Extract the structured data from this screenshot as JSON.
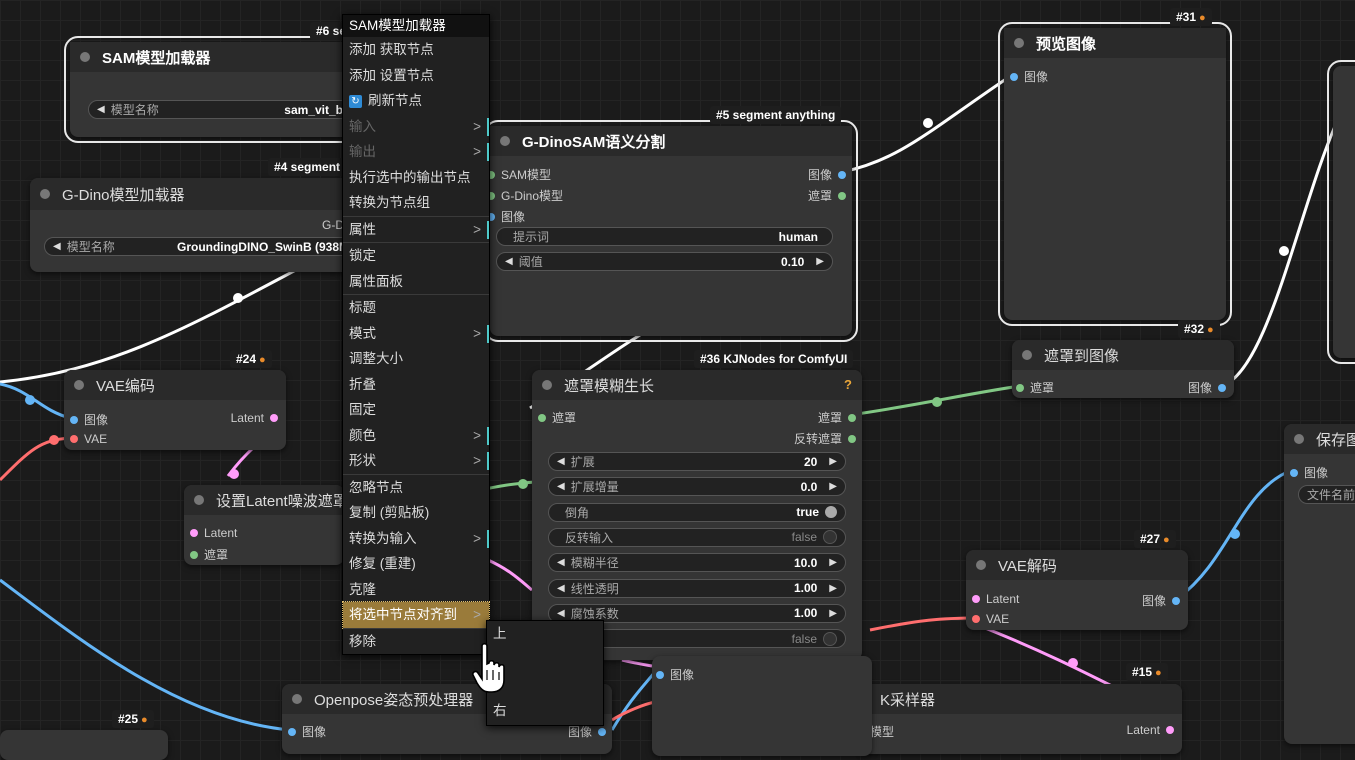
{
  "menu": {
    "title": "SAM模型加载器",
    "items": [
      {
        "label": "添加 获取节点",
        "submenu": false,
        "disabled": false,
        "sep": false
      },
      {
        "label": "添加 设置节点",
        "submenu": false,
        "disabled": false,
        "sep": false
      },
      {
        "label": "刷新节点",
        "submenu": false,
        "disabled": false,
        "sep": false,
        "icon": "refresh-icon"
      },
      {
        "label": "输入",
        "submenu": true,
        "disabled": true,
        "sep": false
      },
      {
        "label": "输出",
        "submenu": true,
        "disabled": true,
        "sep": false
      },
      {
        "label": "执行选中的输出节点",
        "submenu": false,
        "disabled": false,
        "sep": false
      },
      {
        "label": "转换为节点组",
        "submenu": false,
        "disabled": false,
        "sep": false
      },
      {
        "label": "属性",
        "submenu": true,
        "disabled": false,
        "sep": true
      },
      {
        "label": "锁定",
        "submenu": false,
        "disabled": false,
        "sep": true
      },
      {
        "label": "属性面板",
        "submenu": false,
        "disabled": false,
        "sep": false
      },
      {
        "label": "标题",
        "submenu": false,
        "disabled": false,
        "sep": true
      },
      {
        "label": "模式",
        "submenu": true,
        "disabled": false,
        "sep": false
      },
      {
        "label": "调整大小",
        "submenu": false,
        "disabled": false,
        "sep": false
      },
      {
        "label": "折叠",
        "submenu": false,
        "disabled": false,
        "sep": false
      },
      {
        "label": "固定",
        "submenu": false,
        "disabled": false,
        "sep": false
      },
      {
        "label": "颜色",
        "submenu": true,
        "disabled": false,
        "sep": false
      },
      {
        "label": "形状",
        "submenu": true,
        "disabled": false,
        "sep": false
      },
      {
        "label": "忽略节点",
        "submenu": false,
        "disabled": false,
        "sep": true
      },
      {
        "label": "复制 (剪贴板)",
        "submenu": false,
        "disabled": false,
        "sep": false
      },
      {
        "label": "转换为输入",
        "submenu": true,
        "disabled": false,
        "sep": false
      },
      {
        "label": "修复 (重建)",
        "submenu": false,
        "disabled": false,
        "sep": false
      },
      {
        "label": "克隆",
        "submenu": false,
        "disabled": false,
        "sep": false
      },
      {
        "label": "将选中节点对齐到",
        "submenu": true,
        "disabled": false,
        "sep": false,
        "active": true
      },
      {
        "label": "移除",
        "submenu": false,
        "disabled": false,
        "sep": true
      }
    ],
    "submenu_items": [
      "上",
      "",
      "",
      "右"
    ]
  },
  "nodes": {
    "sam_loader": {
      "badge": "#6 se",
      "title": "SAM模型加载器",
      "widget_label": "模型名称",
      "widget_value": "sam_vit_b"
    },
    "gdino_loader": {
      "badge": "#4 segment",
      "title": "G-Dino模型加载器",
      "extra": "G-D",
      "widget_label": "模型名称",
      "widget_value": "GroundingDINO_SwinB (938M"
    },
    "gdino_sam": {
      "badge": "#5 segment anything",
      "title": "G-DinoSAM语义分割",
      "inputs": [
        "SAM模型",
        "G-Dino模型",
        "图像"
      ],
      "outputs": [
        "图像",
        "遮罩"
      ],
      "prompt_label": "提示词",
      "prompt_value": "human",
      "threshold_label": "阈值",
      "threshold_value": "0.10"
    },
    "preview": {
      "badge": "#31",
      "title": "预览图像",
      "input": "图像"
    },
    "mask_to_image": {
      "badge": "#32",
      "title": "遮罩到图像",
      "input": "遮罩",
      "output": "图像"
    },
    "vae_encode": {
      "badge": "#24",
      "title": "VAE编码",
      "inputs": [
        "图像",
        "VAE"
      ],
      "output": "Latent"
    },
    "set_latent_noise": {
      "title": "设置Latent噪波遮罩",
      "inputs": [
        "Latent",
        "遮罩"
      ]
    },
    "grow_mask_blur": {
      "badge": "#36 KJNodes for ComfyUI",
      "title": "遮罩模糊生长",
      "help": "?",
      "input": "遮罩",
      "outputs": [
        "遮罩",
        "反转遮罩"
      ],
      "widgets": [
        {
          "label": "扩展",
          "value": "20",
          "kind": "num"
        },
        {
          "label": "扩展增量",
          "value": "0.0",
          "kind": "num"
        },
        {
          "label": "倒角",
          "value": "true",
          "kind": "toggle"
        },
        {
          "label": "反转输入",
          "value": "false",
          "kind": "toggle"
        },
        {
          "label": "模糊半径",
          "value": "10.0",
          "kind": "num"
        },
        {
          "label": "线性透明",
          "value": "1.00",
          "kind": "num"
        },
        {
          "label": "腐蚀系数",
          "value": "1.00",
          "kind": "num"
        },
        {
          "label": "es",
          "value": "false",
          "kind": "toggle"
        }
      ]
    },
    "vae_decode": {
      "badge": "#27",
      "title": "VAE解码",
      "inputs": [
        "Latent",
        "VAE"
      ],
      "output": "图像"
    },
    "save_image": {
      "title": "保存图",
      "input": "图像",
      "widget_label": "文件名前"
    },
    "ksampler": {
      "badge": "#15",
      "title": "K采样器",
      "input": "模型",
      "output": "Latent"
    },
    "openpose": {
      "title": "Openpose姿态预处理器",
      "input": "图像",
      "output": "图像"
    },
    "node25": {
      "badge": "#25"
    },
    "image_in_node": {
      "input": "图像"
    }
  },
  "colors": {
    "image": "#64b5f6",
    "mask": "#81c784",
    "latent": "#ff9cf9",
    "vae": "#ff6e6e",
    "menu_active": "#9a7b3a"
  }
}
